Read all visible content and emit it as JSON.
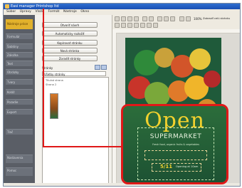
{
  "window": {
    "title": "Easi manager Printshop ltd",
    "menu": [
      "Súbor",
      "Úpravy",
      "Vložiť",
      "Formát",
      "Nástroje",
      "Okno"
    ]
  },
  "left_nav": {
    "items": [
      {
        "label": "Nástroje práce",
        "active": true
      },
      {
        "label": "Formulár"
      },
      {
        "label": "Šablóny"
      },
      {
        "label": "Záložka"
      },
      {
        "label": "Text"
      },
      {
        "label": "Obrázky"
      },
      {
        "label": "Tvary"
      },
      {
        "label": "Koláž"
      },
      {
        "label": "Pozadie"
      },
      {
        "label": "Export"
      },
      {
        "label": "Tlač"
      },
      {
        "label": "Nastavenia"
      },
      {
        "label": "Pomoc"
      }
    ]
  },
  "panel": {
    "buttons": [
      "Otvoriť návrh",
      "Automaticky rozložiť",
      "Kopírovať stránku",
      "Nová stránka",
      "Zoradiť stránky"
    ],
    "section_label": "Stránky",
    "dropdown_value": "Všetky stránky",
    "list_items": [
      "Titulná strana",
      "Strana 2"
    ]
  },
  "canvas": {
    "zoom": "100%",
    "zoom_label": "Zobraziť celú stránku"
  },
  "poster": {
    "headline": "Open",
    "subhead": "SUPERMARKET",
    "tagline": "Fresh food, organic fruits & vegetables",
    "date": "5/11",
    "date_note": "Opening at 10am"
  },
  "colors": {
    "accent_red": "#e01818",
    "poster_green": "#1f5a3a",
    "headline_yellow": "#f2d12e",
    "nav_dark": "#5a5e66",
    "nav_highlight": "#e1b12c"
  }
}
